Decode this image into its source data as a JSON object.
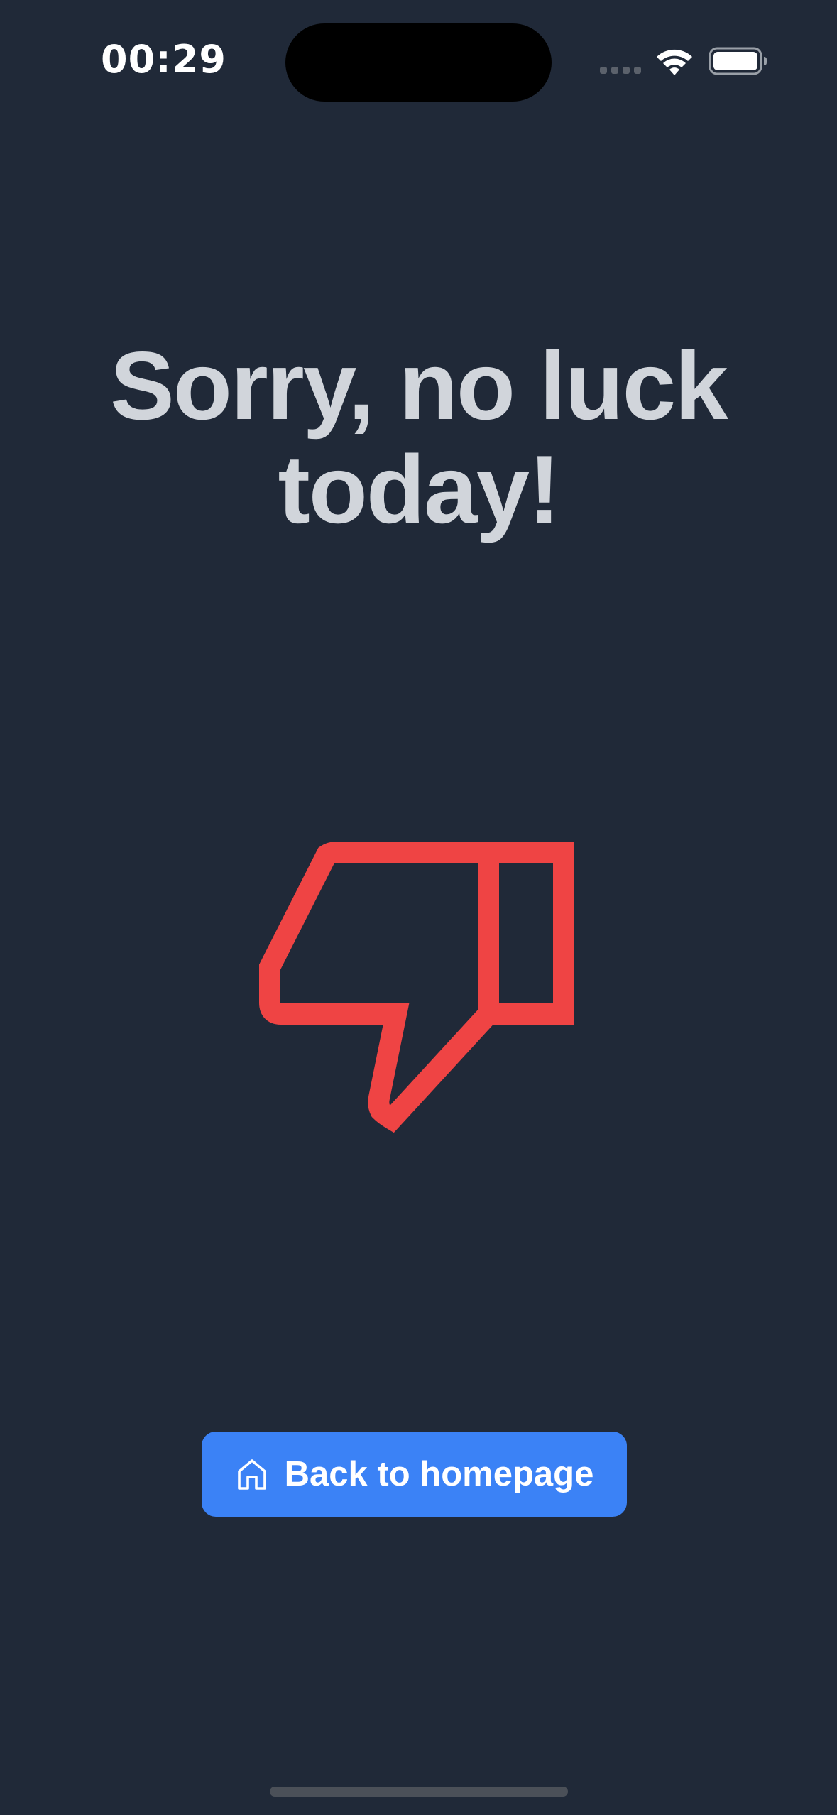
{
  "status_bar": {
    "time": "00:29",
    "icons": [
      "signal-dots-icon",
      "wifi-icon",
      "battery-icon"
    ]
  },
  "main": {
    "title": "Sorry, no luck today!",
    "illustration_icon": "thumbs-down-icon",
    "button": {
      "label": "Back to homepage",
      "icon": "home-icon"
    }
  },
  "colors": {
    "background": "#202938",
    "title": "#d1d5db",
    "icon_red": "#ef4444",
    "button_blue": "#3b82f6",
    "button_text": "#ffffff"
  }
}
